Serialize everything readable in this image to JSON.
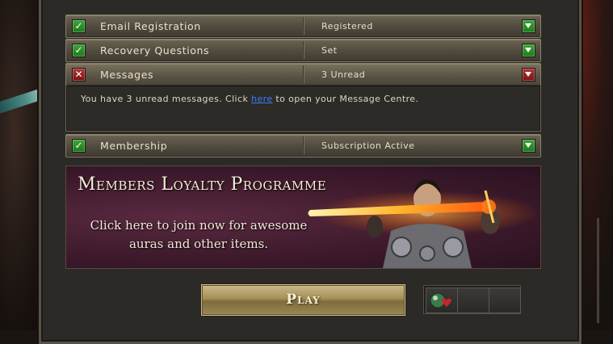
{
  "account_rows": [
    {
      "label": "Email Registration",
      "value": "Registered",
      "status": "ok",
      "expanded": false
    },
    {
      "label": "Recovery Questions",
      "value": "Set",
      "status": "ok",
      "expanded": false
    },
    {
      "label": "Messages",
      "value": "3 Unread",
      "status": "bad",
      "expanded": true
    },
    {
      "label": "Membership",
      "value": "Subscription Active",
      "status": "ok",
      "expanded": false
    }
  ],
  "messages_panel": {
    "text_before": "You have 3 unread messages. Click ",
    "link_text": "here",
    "text_after": " to open your Message Centre."
  },
  "banner": {
    "title": "Members Loyalty Programme",
    "subtitle_line1": "Click here to join now for awesome",
    "subtitle_line2": "auras and other items."
  },
  "play_button": {
    "label": "Play"
  },
  "colors": {
    "ok": "#2e9a2b",
    "bad": "#a51f22",
    "link": "#3a7dff"
  },
  "icons": {
    "ok": "check-icon",
    "bad": "cross-icon",
    "expand": "chevron-down-icon"
  }
}
